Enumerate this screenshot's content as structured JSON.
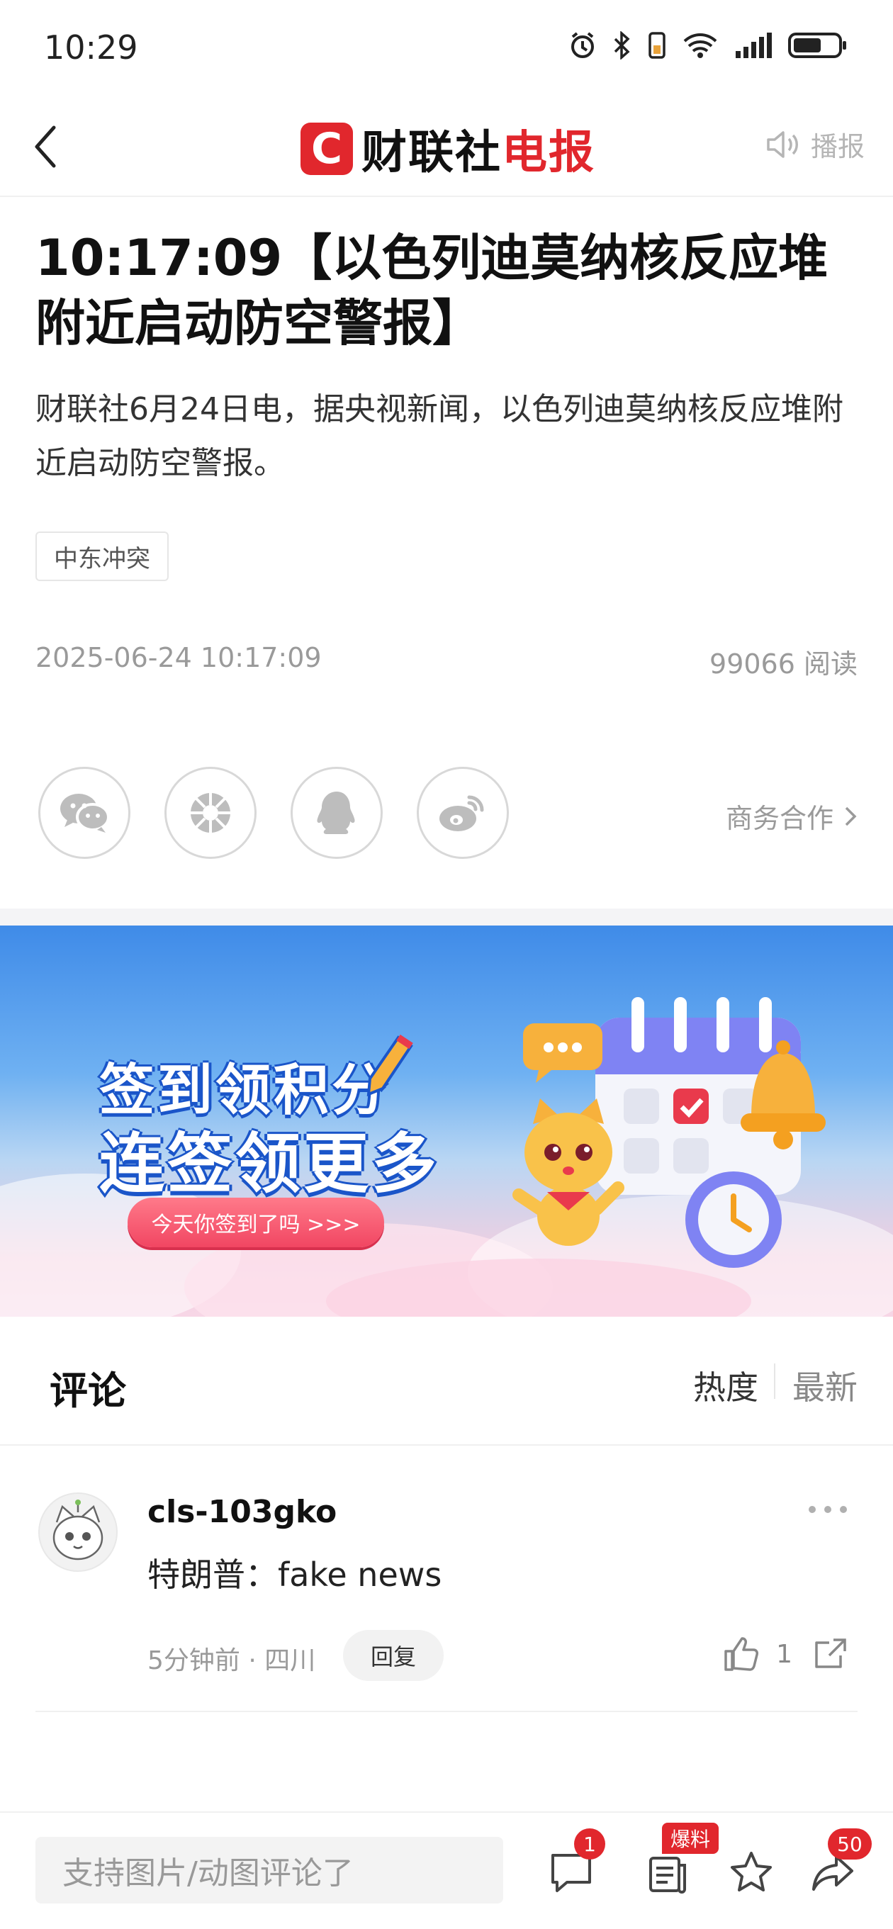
{
  "status_bar": {
    "time": "10:29"
  },
  "header": {
    "logo_mark": "C",
    "logo_text_a": "财联社",
    "logo_text_b": "电报",
    "broadcast_label": "播报"
  },
  "article": {
    "title": "10:17:09【以色列迪莫纳核反应堆附近启动防空警报】",
    "body": "财联社6月24日电，据央视新闻，以色列迪莫纳核反应堆附近启动防空警报。",
    "tag": "中东冲突",
    "date": "2025-06-24 10:17:09",
    "reads": "99066 阅读"
  },
  "share": {
    "icons": [
      "wechat-icon",
      "moments-icon",
      "qq-icon",
      "weibo-icon"
    ],
    "business_label": "商务合作"
  },
  "banner": {
    "line1": "签到领积分",
    "line2": "连签领更多",
    "button": "今天你签到了吗 >>>"
  },
  "comments": {
    "title": "评论",
    "sort_hot": "热度",
    "sort_new": "最新",
    "items": [
      {
        "username": "cls-103gko",
        "text": "特朗普：fake news",
        "meta": "5分钟前 · 四川",
        "reply_label": "回复",
        "likes": "1"
      }
    ]
  },
  "bottom_bar": {
    "input_placeholder": "支持图片/动图评论了",
    "comment_badge": "1",
    "scoop_label": "爆料",
    "share_badge": "50"
  },
  "colors": {
    "brand_red": "#e1272d",
    "banner_blue": "#3f8be8"
  }
}
